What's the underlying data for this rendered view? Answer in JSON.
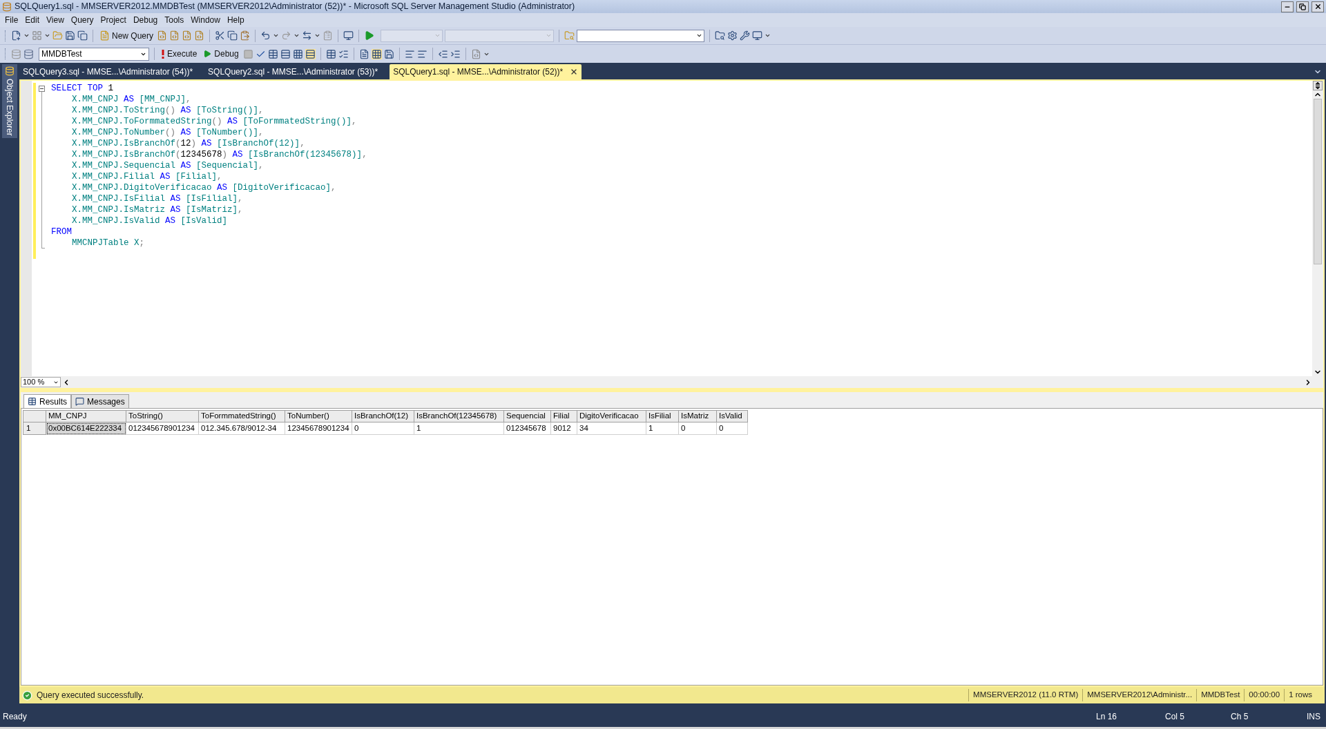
{
  "window": {
    "title": "SQLQuery1.sql - MMSERVER2012.MMDBTest (MMSERVER2012\\Administrator (52))* - Microsoft SQL Server Management Studio (Administrator)"
  },
  "menu": [
    "File",
    "Edit",
    "View",
    "Query",
    "Project",
    "Debug",
    "Tools",
    "Window",
    "Help"
  ],
  "toolbar": {
    "new_query": "New Query",
    "database": "MMDBTest",
    "execute": "Execute",
    "debug": "Debug"
  },
  "side_tab": "Object Explorer",
  "doc_tabs": [
    {
      "label": "SQLQuery3.sql - MMSE...\\Administrator (54))*",
      "selected": false
    },
    {
      "label": "SQLQuery2.sql - MMSE...\\Administrator (53))*",
      "selected": false
    },
    {
      "label": "SQLQuery1.sql - MMSE...\\Administrator (52))*",
      "selected": true
    }
  ],
  "editor": {
    "zoom": "100 %",
    "lines": [
      [
        {
          "kind": "kw",
          "t": "SELECT TOP "
        },
        {
          "kind": "num",
          "t": "1"
        }
      ],
      [
        {
          "kind": "id",
          "t": "    X.MM_CNPJ"
        },
        {
          "kind": "kw",
          "t": " AS "
        },
        {
          "kind": "id",
          "t": "[MM_CNPJ]"
        },
        {
          "kind": "p",
          "t": ","
        }
      ],
      [
        {
          "kind": "id",
          "t": "    X.MM_CNPJ.ToString"
        },
        {
          "kind": "p",
          "t": "()"
        },
        {
          "kind": "kw",
          "t": " AS "
        },
        {
          "kind": "id",
          "t": "[ToString()]"
        },
        {
          "kind": "p",
          "t": ","
        }
      ],
      [
        {
          "kind": "id",
          "t": "    X.MM_CNPJ.ToFormmatedString"
        },
        {
          "kind": "p",
          "t": "()"
        },
        {
          "kind": "kw",
          "t": " AS "
        },
        {
          "kind": "id",
          "t": "[ToFormmatedString()]"
        },
        {
          "kind": "p",
          "t": ","
        }
      ],
      [
        {
          "kind": "id",
          "t": "    X.MM_CNPJ.ToNumber"
        },
        {
          "kind": "p",
          "t": "()"
        },
        {
          "kind": "kw",
          "t": " AS "
        },
        {
          "kind": "id",
          "t": "[ToNumber()]"
        },
        {
          "kind": "p",
          "t": ","
        }
      ],
      [
        {
          "kind": "id",
          "t": "    X.MM_CNPJ.IsBranchOf"
        },
        {
          "kind": "p",
          "t": "("
        },
        {
          "kind": "num",
          "t": "12"
        },
        {
          "kind": "p",
          "t": ")"
        },
        {
          "kind": "kw",
          "t": " AS "
        },
        {
          "kind": "id",
          "t": "[IsBranchOf(12)]"
        },
        {
          "kind": "p",
          "t": ","
        }
      ],
      [
        {
          "kind": "id",
          "t": "    X.MM_CNPJ.IsBranchOf"
        },
        {
          "kind": "p",
          "t": "("
        },
        {
          "kind": "num",
          "t": "12345678"
        },
        {
          "kind": "p",
          "t": ")"
        },
        {
          "kind": "kw",
          "t": " AS "
        },
        {
          "kind": "id",
          "t": "[IsBranchOf(12345678)]"
        },
        {
          "kind": "p",
          "t": ","
        }
      ],
      [
        {
          "kind": "id",
          "t": "    X.MM_CNPJ.Sequencial"
        },
        {
          "kind": "kw",
          "t": " AS "
        },
        {
          "kind": "id",
          "t": "[Sequencial]"
        },
        {
          "kind": "p",
          "t": ","
        }
      ],
      [
        {
          "kind": "id",
          "t": "    X.MM_CNPJ.Filial"
        },
        {
          "kind": "kw",
          "t": " AS "
        },
        {
          "kind": "id",
          "t": "[Filial]"
        },
        {
          "kind": "p",
          "t": ","
        }
      ],
      [
        {
          "kind": "id",
          "t": "    X.MM_CNPJ.DigitoVerificacao"
        },
        {
          "kind": "kw",
          "t": " AS "
        },
        {
          "kind": "id",
          "t": "[DigitoVerificacao]"
        },
        {
          "kind": "p",
          "t": ","
        }
      ],
      [
        {
          "kind": "id",
          "t": "    X.MM_CNPJ.IsFilial"
        },
        {
          "kind": "kw",
          "t": " AS "
        },
        {
          "kind": "id",
          "t": "[IsFilial]"
        },
        {
          "kind": "p",
          "t": ","
        }
      ],
      [
        {
          "kind": "id",
          "t": "    X.MM_CNPJ.IsMatriz"
        },
        {
          "kind": "kw",
          "t": " AS "
        },
        {
          "kind": "id",
          "t": "[IsMatriz]"
        },
        {
          "kind": "p",
          "t": ","
        }
      ],
      [
        {
          "kind": "id",
          "t": "    X.MM_CNPJ.IsValid"
        },
        {
          "kind": "kw",
          "t": " AS "
        },
        {
          "kind": "id",
          "t": "[IsValid]"
        }
      ],
      [
        {
          "kind": "kw",
          "t": "FROM"
        }
      ],
      [
        {
          "kind": "id",
          "t": "    MMCNPJTable X"
        },
        {
          "kind": "p",
          "t": ";"
        }
      ]
    ]
  },
  "results": {
    "tabs": [
      {
        "label": "Results",
        "selected": true
      },
      {
        "label": "Messages",
        "selected": false
      }
    ],
    "columns": [
      "MM_CNPJ",
      "ToString()",
      "ToFormmatedString()",
      "ToNumber()",
      "IsBranchOf(12)",
      "IsBranchOf(12345678)",
      "Sequencial",
      "Filial",
      "DigitoVerificacao",
      "IsFilial",
      "IsMatriz",
      "IsValid"
    ],
    "rows": [
      {
        "number": "1",
        "cells": [
          {
            "text": "0x00BC614E222334",
            "selected": true
          },
          {
            "text": "012345678901234",
            "selected": false
          },
          {
            "text": "012.345.678/9012-34",
            "selected": false
          },
          {
            "text": "12345678901234",
            "selected": false
          },
          {
            "text": "0",
            "selected": false
          },
          {
            "text": "1",
            "selected": false
          },
          {
            "text": "012345678",
            "selected": false
          },
          {
            "text": "9012",
            "selected": false
          },
          {
            "text": "34",
            "selected": false
          },
          {
            "text": "1",
            "selected": false
          },
          {
            "text": "0",
            "selected": false
          },
          {
            "text": "0",
            "selected": false
          }
        ]
      }
    ]
  },
  "message_bar": {
    "text": "Query executed successfully.",
    "fields": [
      "MMSERVER2012 (11.0 RTM)",
      "MMSERVER2012\\Administr...",
      "MMDBTest",
      "00:00:00",
      "1 rows"
    ]
  },
  "status_bar": {
    "text": "Ready",
    "ln": "Ln 16",
    "col": "Col 5",
    "ch": "Ch 5",
    "mode": "INS"
  }
}
